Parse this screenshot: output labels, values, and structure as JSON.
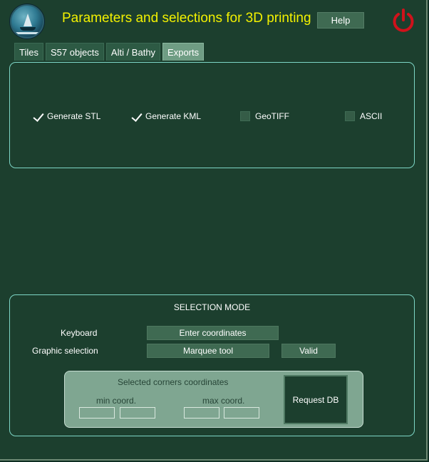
{
  "header": {
    "title": "Parameters and selections for 3D printing",
    "help_label": "Help",
    "logo_icon": "globe-sailboat-logo",
    "power_icon": "power-icon",
    "accent_color": "#f3f100",
    "power_color": "#d0121b"
  },
  "tabs": [
    {
      "label": "Tiles",
      "active": false
    },
    {
      "label": "S57 objects",
      "active": false
    },
    {
      "label": "Alti / Bathy",
      "active": false
    },
    {
      "label": "Exports",
      "active": true
    }
  ],
  "exports": {
    "options": [
      {
        "label": "Generate STL",
        "checked": true
      },
      {
        "label": "Generate KML",
        "checked": true
      },
      {
        "label": "GeoTIFF",
        "checked": false
      },
      {
        "label": "ASCII",
        "checked": false
      }
    ]
  },
  "selection": {
    "title": "SELECTION MODE",
    "keyboard_label": "Keyboard",
    "enter_coords_label": "Enter coordinates",
    "graphic_label": "Graphic selection",
    "marquee_label": "Marquee tool",
    "valid_label": "Valid",
    "corners": {
      "title": "Selected corners coordinates",
      "min_label": "min coord.",
      "max_label": "max coord.",
      "min_x": "",
      "min_y": "",
      "max_x": "",
      "max_y": ""
    },
    "request_label": "Request DB"
  },
  "colors": {
    "background": "#1c3f2e",
    "panel_border": "#7dd6c6",
    "button": "#3f6a52",
    "active_tab": "#6f9d84",
    "coords_box": "#7fa691"
  }
}
